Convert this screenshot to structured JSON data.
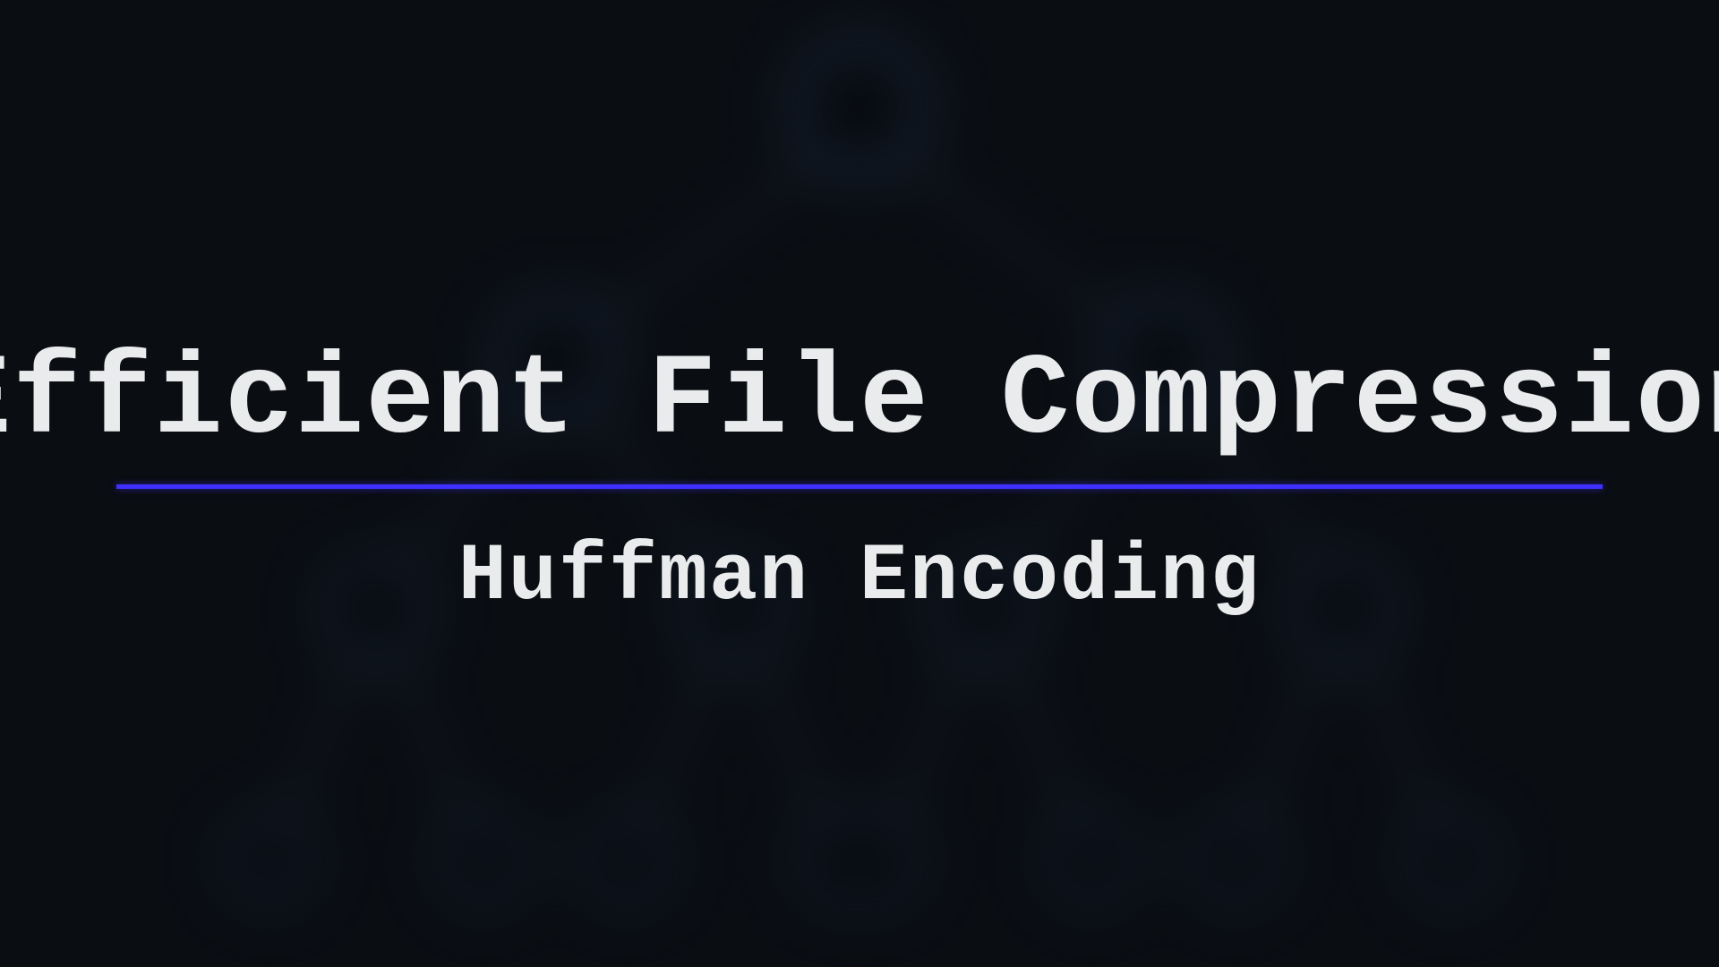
{
  "title": "Efficient File Compression",
  "subtitle": "Huffman Encoding",
  "colors": {
    "background": "#0a0d12",
    "text": "#eaebed",
    "accent": "#4030ff"
  }
}
